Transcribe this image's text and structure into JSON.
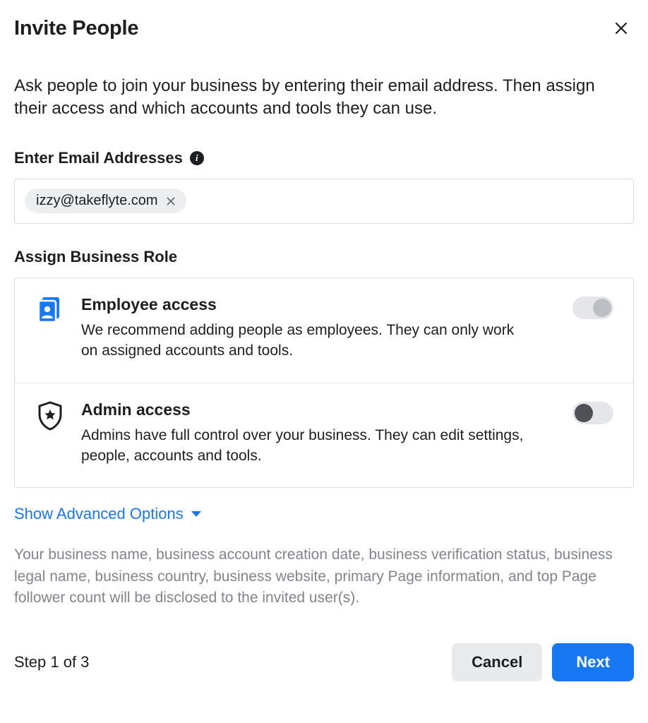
{
  "header": {
    "title": "Invite People"
  },
  "intro": "Ask people to join your business by entering their email address. Then assign their access and which accounts and tools they can use.",
  "emailSection": {
    "label": "Enter Email Addresses",
    "chips": [
      "izzy@takeflyte.com"
    ]
  },
  "roleSection": {
    "label": "Assign Business Role",
    "roles": [
      {
        "key": "employee",
        "title": "Employee access",
        "desc": "We recommend adding people as employees. They can only work on assigned accounts and tools.",
        "toggleStyle": "off-light"
      },
      {
        "key": "admin",
        "title": "Admin access",
        "desc": "Admins have full control over your business. They can edit settings, people, accounts and tools.",
        "toggleStyle": "off-dark"
      }
    ]
  },
  "advancedLabel": "Show Advanced Options",
  "disclosure": "Your business name, business account creation date, business verification status, business legal name, business country, business website, primary Page information, and top Page follower count will be disclosed to the invited user(s).",
  "footer": {
    "step": "Step 1 of 3",
    "cancel": "Cancel",
    "next": "Next"
  }
}
